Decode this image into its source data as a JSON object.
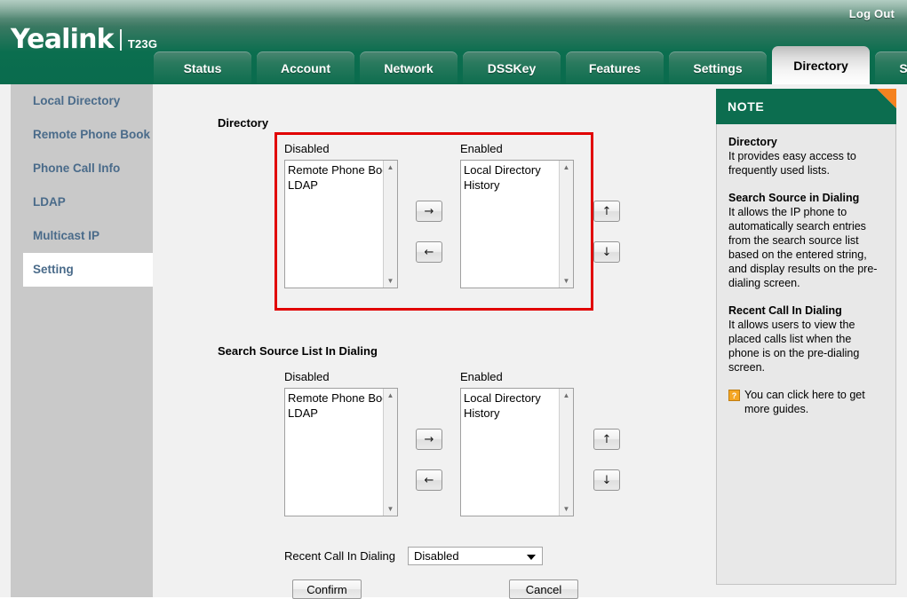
{
  "header": {
    "logo_name": "Yealink",
    "logo_model": "T23G",
    "logout_label": "Log Out"
  },
  "tabs": [
    {
      "label": "Status",
      "active": false
    },
    {
      "label": "Account",
      "active": false
    },
    {
      "label": "Network",
      "active": false
    },
    {
      "label": "DSSKey",
      "active": false
    },
    {
      "label": "Features",
      "active": false
    },
    {
      "label": "Settings",
      "active": false
    },
    {
      "label": "Directory",
      "active": true
    },
    {
      "label": "Security",
      "active": false
    }
  ],
  "sidebar": {
    "items": [
      {
        "label": "Local Directory",
        "active": false
      },
      {
        "label": "Remote Phone Book",
        "active": false
      },
      {
        "label": "Phone Call Info",
        "active": false
      },
      {
        "label": "LDAP",
        "active": false
      },
      {
        "label": "Multicast IP",
        "active": false
      },
      {
        "label": "Setting",
        "active": true
      }
    ]
  },
  "main": {
    "sections": [
      {
        "title": "Directory",
        "highlighted": true,
        "disabled_header": "Disabled",
        "enabled_header": "Enabled",
        "disabled_items": [
          "Remote Phone Boo",
          "LDAP"
        ],
        "enabled_items": [
          "Local Directory",
          "History"
        ],
        "move_right_icon": "→",
        "move_left_icon": "←",
        "move_up_icon": "↑",
        "move_down_icon": "↓"
      },
      {
        "title": "Search Source List In Dialing",
        "highlighted": false,
        "disabled_header": "Disabled",
        "enabled_header": "Enabled",
        "disabled_items": [
          "Remote Phone Boo",
          "LDAP"
        ],
        "enabled_items": [
          "Local Directory",
          "History"
        ],
        "move_right_icon": "→",
        "move_left_icon": "←",
        "move_up_icon": "↑",
        "move_down_icon": "↓"
      }
    ],
    "recent_call": {
      "label": "Recent Call In Dialing",
      "value": "Disabled"
    },
    "confirm_label": "Confirm",
    "cancel_label": "Cancel"
  },
  "note": {
    "header": "NOTE",
    "blocks": [
      {
        "title": "Directory",
        "text": "It provides easy access to frequently used lists."
      },
      {
        "title": "Search Source in Dialing",
        "text": "It allows the IP phone to automatically search entries from the search source list based on the entered string, and display results on the pre-dialing screen."
      },
      {
        "title": "Recent Call In Dialing",
        "text": "It allows users to view the placed calls list when the phone is on the pre-dialing screen."
      }
    ],
    "guide_text": "You can click here to get more guides.",
    "help_icon_glyph": "?"
  },
  "scrollbar": {
    "up_glyph": "▲",
    "down_glyph": "▼"
  },
  "colors": {
    "brand_green": "#0c6d4f",
    "highlight_red": "#e10000",
    "accent_orange": "#f58220",
    "sidebar_link": "#4a6b8a"
  }
}
